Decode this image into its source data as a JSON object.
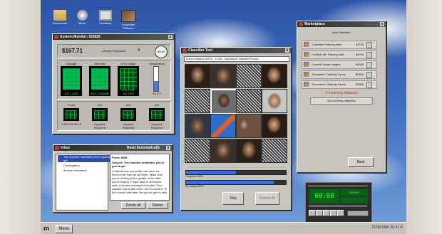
{
  "desktop_icons": [
    {
      "label": "Documents",
      "icon": "folder-icon"
    },
    {
      "label": "Music",
      "icon": "disc-icon"
    },
    {
      "label": "Visualizer",
      "icon": "monitor-icon"
    },
    {
      "label": "Expanded Software",
      "icon": "app-icon"
    }
  ],
  "system_monitor": {
    "title": "System Monitor: ID3825",
    "balance": "$167.71",
    "unread": "Unread Processed",
    "unread_count": "5",
    "cost": "$0.99",
    "labels": {
      "storage": "Storage",
      "memory": "Memory",
      "cpu": "CPU Usage",
      "temp": "Temperature"
    },
    "storage_val": "672 / 1GB",
    "memory_val": "643 / 1024MB",
    "cpu_val": "50/1 / 100 GFLOPS",
    "temp_val": "54.9°F",
    "sub": [
      {
        "label": "Power",
        "value": "1,000 kW $0.18"
      },
      {
        "label": "N/A",
        "value": "Upgrade Required"
      },
      {
        "label": "N/A",
        "value": "Upgrade Required"
      },
      {
        "label": "N/A",
        "value": "Upgrade Required"
      }
    ]
  },
  "classifier": {
    "title": "Classifier Tool",
    "dataset": "Current Dataset: B1876 - 0.2230 - Unpolished Unwanted Pictures",
    "progress_label": "Progress 50%",
    "progress": 0.5,
    "accuracy_label": "Accuracy 88%",
    "accuracy": 0.88,
    "skip": "Skip",
    "submit": "Submit All"
  },
  "marketplace": {
    "title": "Marketplace",
    "header": "Item Selection",
    "items": [
      {
        "name": "Classified Training data",
        "price": "$3760"
      },
      {
        "name": "Certified ML Training data",
        "price": "$4700"
      },
      {
        "name": "Curated Social Images",
        "price": "$2920"
      },
      {
        "name": "Generated Celebrity Faces",
        "price": "$2560"
      },
      {
        "name": "Generated Celebrity Faces",
        "price": "$2560"
      }
    ],
    "incoming": "- 0 incoming datasets -",
    "no_incoming": "No incoming datasets!",
    "back": "Back"
  },
  "inbox": {
    "title": "Inbox",
    "read_auto": "Read Automatically",
    "messages": [
      {
        "subject": "The moment motivates you're gonna get"
      },
      {
        "subject": "Confirmation"
      },
      {
        "subject": "Access reinstated!"
      }
    ],
    "from": "From: 8658",
    "subject": "Subject: The moment motivates you're gonna get",
    "body": "I noticed now you pretty new here, so here's a tip from an old timer. Make sure you're looking at the quality of the data you're buying. Forget data or corrupted data, it causes nothing but trouble. Pura classes cost a little more, but it's worth it. I'll be in touch with later like you've got no idea",
    "delete_all": "Delete all",
    "delete": "Delete"
  },
  "player": {
    "time": "00:08",
    "track": "GRAVE"
  },
  "taskbar": {
    "logo": "m",
    "menu": "Menu",
    "clock": "22/09/1996 05:47 R"
  }
}
